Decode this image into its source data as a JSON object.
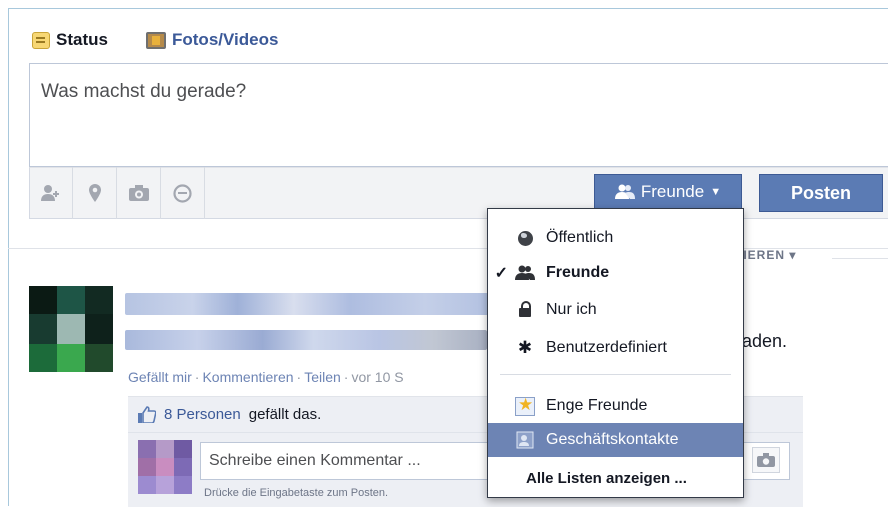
{
  "composer": {
    "tabs": {
      "status": "Status",
      "photos": "Fotos/Videos"
    },
    "placeholder": "Was machst du gerade?",
    "tools": [
      "tag-people-icon",
      "location-icon",
      "camera-icon",
      "smiley-icon"
    ],
    "audience_button": "Freunde",
    "post_button": "Posten"
  },
  "feed": {
    "sort_label": "TIEREN ▾",
    "post_text_tail": "aden.",
    "actions": {
      "like": "Gefällt mir",
      "comment": "Kommentieren",
      "share": "Teilen",
      "time": "vor 10 S"
    },
    "likes": {
      "count": "8 Personen",
      "suffix": "gefällt das."
    },
    "comment": {
      "placeholder": "Schreibe einen Kommentar ...",
      "hint": "Drücke die Eingabetaste zum Posten."
    }
  },
  "audience_menu": {
    "selected": "Freunde",
    "items": [
      {
        "label": "Öffentlich",
        "icon": "globe-icon"
      },
      {
        "label": "Freunde",
        "icon": "friends-icon",
        "checked": true
      },
      {
        "label": "Nur ich",
        "icon": "lock-icon"
      },
      {
        "label": "Benutzerdefiniert",
        "icon": "gear-icon"
      },
      {
        "label": "Enge Freunde",
        "icon": "star-list-icon"
      },
      {
        "label": "Geschäftskontakte",
        "icon": "business-list-icon",
        "highlighted": true
      },
      {
        "label": "Alle Listen anzeigen ..."
      }
    ]
  },
  "colors": {
    "fb_blue": "#5b7bb4",
    "link": "#3b5998",
    "highlight": "#6d84b4"
  }
}
